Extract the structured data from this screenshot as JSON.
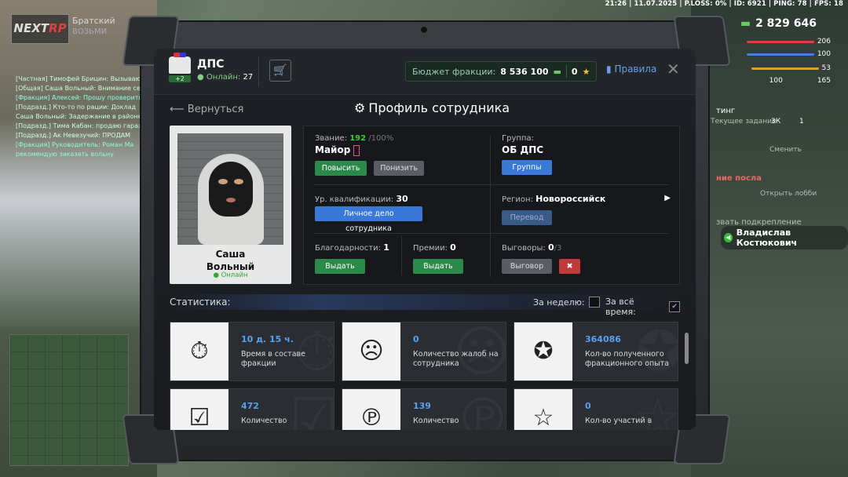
{
  "hud": {
    "topbar": "21:26 | 11.07.2025 | P.LOSS: 0% | ID: 6921 | PING: 78 | FPS: 18",
    "logo_a": "NEXT",
    "logo_b": "RP",
    "server_name": "Братский",
    "server_sub": "ВОЗЬМИ",
    "money": "2 829 646",
    "stats": [
      {
        "value": "206",
        "color": "#e04040"
      },
      {
        "value": "100",
        "color": "#4080e0"
      },
      {
        "value": "53",
        "color": "#e0a030"
      },
      {
        "value": "165",
        "color": "#aaaaaa"
      }
    ],
    "stat_left": "100",
    "chat": [
      "[Частная] Тимофей Брицин: Вызываю",
      "[Общая] Саша Вольный: Внимание сейчас",
      "[Фракция] Алексей: Прошу проверить",
      "[Подразд.] Кто-то по рации: Доклад",
      "Саша Вольный: Задержание в районе",
      "[Подразд.] Тима Кабан: продаю гараж",
      "[Подразд.] Ак Невезучий: ПРОДАМ",
      "[Фракция] Руководитель: Роман Ма",
      "рекомендую заказать вольну"
    ],
    "notification": "Владислав Костюкович",
    "rp_texts": {
      "ting": "тинг",
      "task": "Текущее задание",
      "smena": "Сменить",
      "task2": "ние посла",
      "lobby": "Открыть лобби",
      "reinforce": "звать подкрепление",
      "count_3k": "3К",
      "count_1": "1"
    }
  },
  "header": {
    "faction": "ДПС",
    "level": "+2",
    "online_label": "Онлайн:",
    "online_count": "27",
    "budget_label": "Бюджет фракции:",
    "budget_value": "8 536 100",
    "stars_value": "0",
    "rules_label": "Правила"
  },
  "nav": {
    "back_label": "Вернуться",
    "page_title": "Профиль сотрудника"
  },
  "profile": {
    "first_name": "Саша",
    "last_name": "Вольный",
    "status": "Онлайн"
  },
  "info": {
    "rank_label": "Звание:",
    "rank_points": "192",
    "rank_max": "/100%",
    "rank_name": "Майор",
    "promote_label": "Повысить",
    "demote_label": "Понизить",
    "group_label": "Группа:",
    "group_name": "ОБ ДПС",
    "groups_button": "Группы",
    "qual_label": "Ур. квалификации:",
    "qual_value": "30",
    "personal_file_button": "Личное дело сотрудника",
    "region_label": "Регион:",
    "region_name": "Новороссийск",
    "transfer_button": "Перевод",
    "thanks_label": "Благодарности:",
    "thanks_value": "1",
    "thanks_button": "Выдать",
    "bonus_label": "Премии:",
    "bonus_value": "0",
    "bonus_button": "Выдать",
    "reprimand_label": "Выговоры:",
    "reprimand_value": "0",
    "reprimand_max": "/3",
    "reprimand_button": "Выговор"
  },
  "statistics": {
    "label": "Статистика:",
    "week_label": "За неделю:",
    "week_checked": false,
    "all_label": "За всё время:",
    "all_checked": true,
    "cards": [
      {
        "value": "10 д. 15 ч.",
        "desc": "Время в составе фракции",
        "icon": "stopwatch-icon",
        "glyph": "⏱"
      },
      {
        "value": "0",
        "desc": "Количество жалоб на сотрудника",
        "icon": "complaint-document-icon",
        "glyph": "☹"
      },
      {
        "value": "364086",
        "desc": "Кол-во полученного фракционного опыта",
        "icon": "exp-stars-icon",
        "glyph": "✪"
      },
      {
        "value": "472",
        "desc": "Количество",
        "icon": "clipboard-icon",
        "glyph": "☑"
      },
      {
        "value": "139",
        "desc": "Количество",
        "icon": "fines-document-icon",
        "glyph": "℗"
      },
      {
        "value": "0",
        "desc": "Кол-во участий в",
        "icon": "star-icon",
        "glyph": "☆"
      }
    ]
  }
}
